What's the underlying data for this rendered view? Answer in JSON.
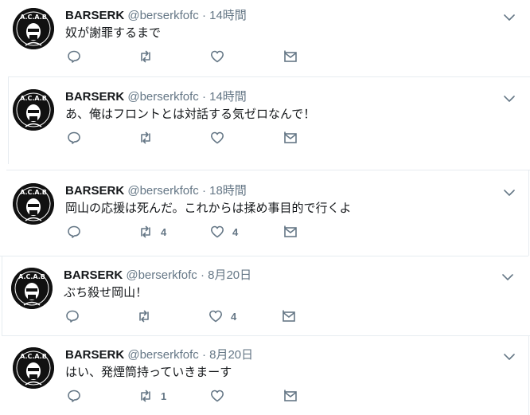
{
  "tweets": [
    {
      "name": "BARSERK",
      "handle": "@berserkfofc",
      "time": "14時間",
      "text": "奴が謝罪するまで",
      "retweets": "",
      "likes": ""
    },
    {
      "name": "BARSERK",
      "handle": "@berserkfofc",
      "time": "14時間",
      "text": "あ、俺はフロントとは対話する気ゼロなんで！",
      "retweets": "",
      "likes": ""
    },
    {
      "name": "BARSERK",
      "handle": "@berserkfofc",
      "time": "18時間",
      "text": "岡山の応援は死んだ。これからは揉め事目的で行くよ",
      "retweets": "4",
      "likes": "4"
    },
    {
      "name": "BARSERK",
      "handle": "@berserkfofc",
      "time": "8月20日",
      "text": "ぶち殺せ岡山！",
      "retweets": "",
      "likes": "4"
    },
    {
      "name": "BARSERK",
      "handle": "@berserkfofc",
      "time": "8月20日",
      "text": "はい、発煙筒持っていきまーす",
      "retweets": "1",
      "likes": ""
    }
  ],
  "separator": " · ",
  "avatar_text": "A.C.A.B",
  "colors": {
    "secondary": "#657786",
    "divider": "#e6ecf0",
    "text": "#14171a"
  }
}
